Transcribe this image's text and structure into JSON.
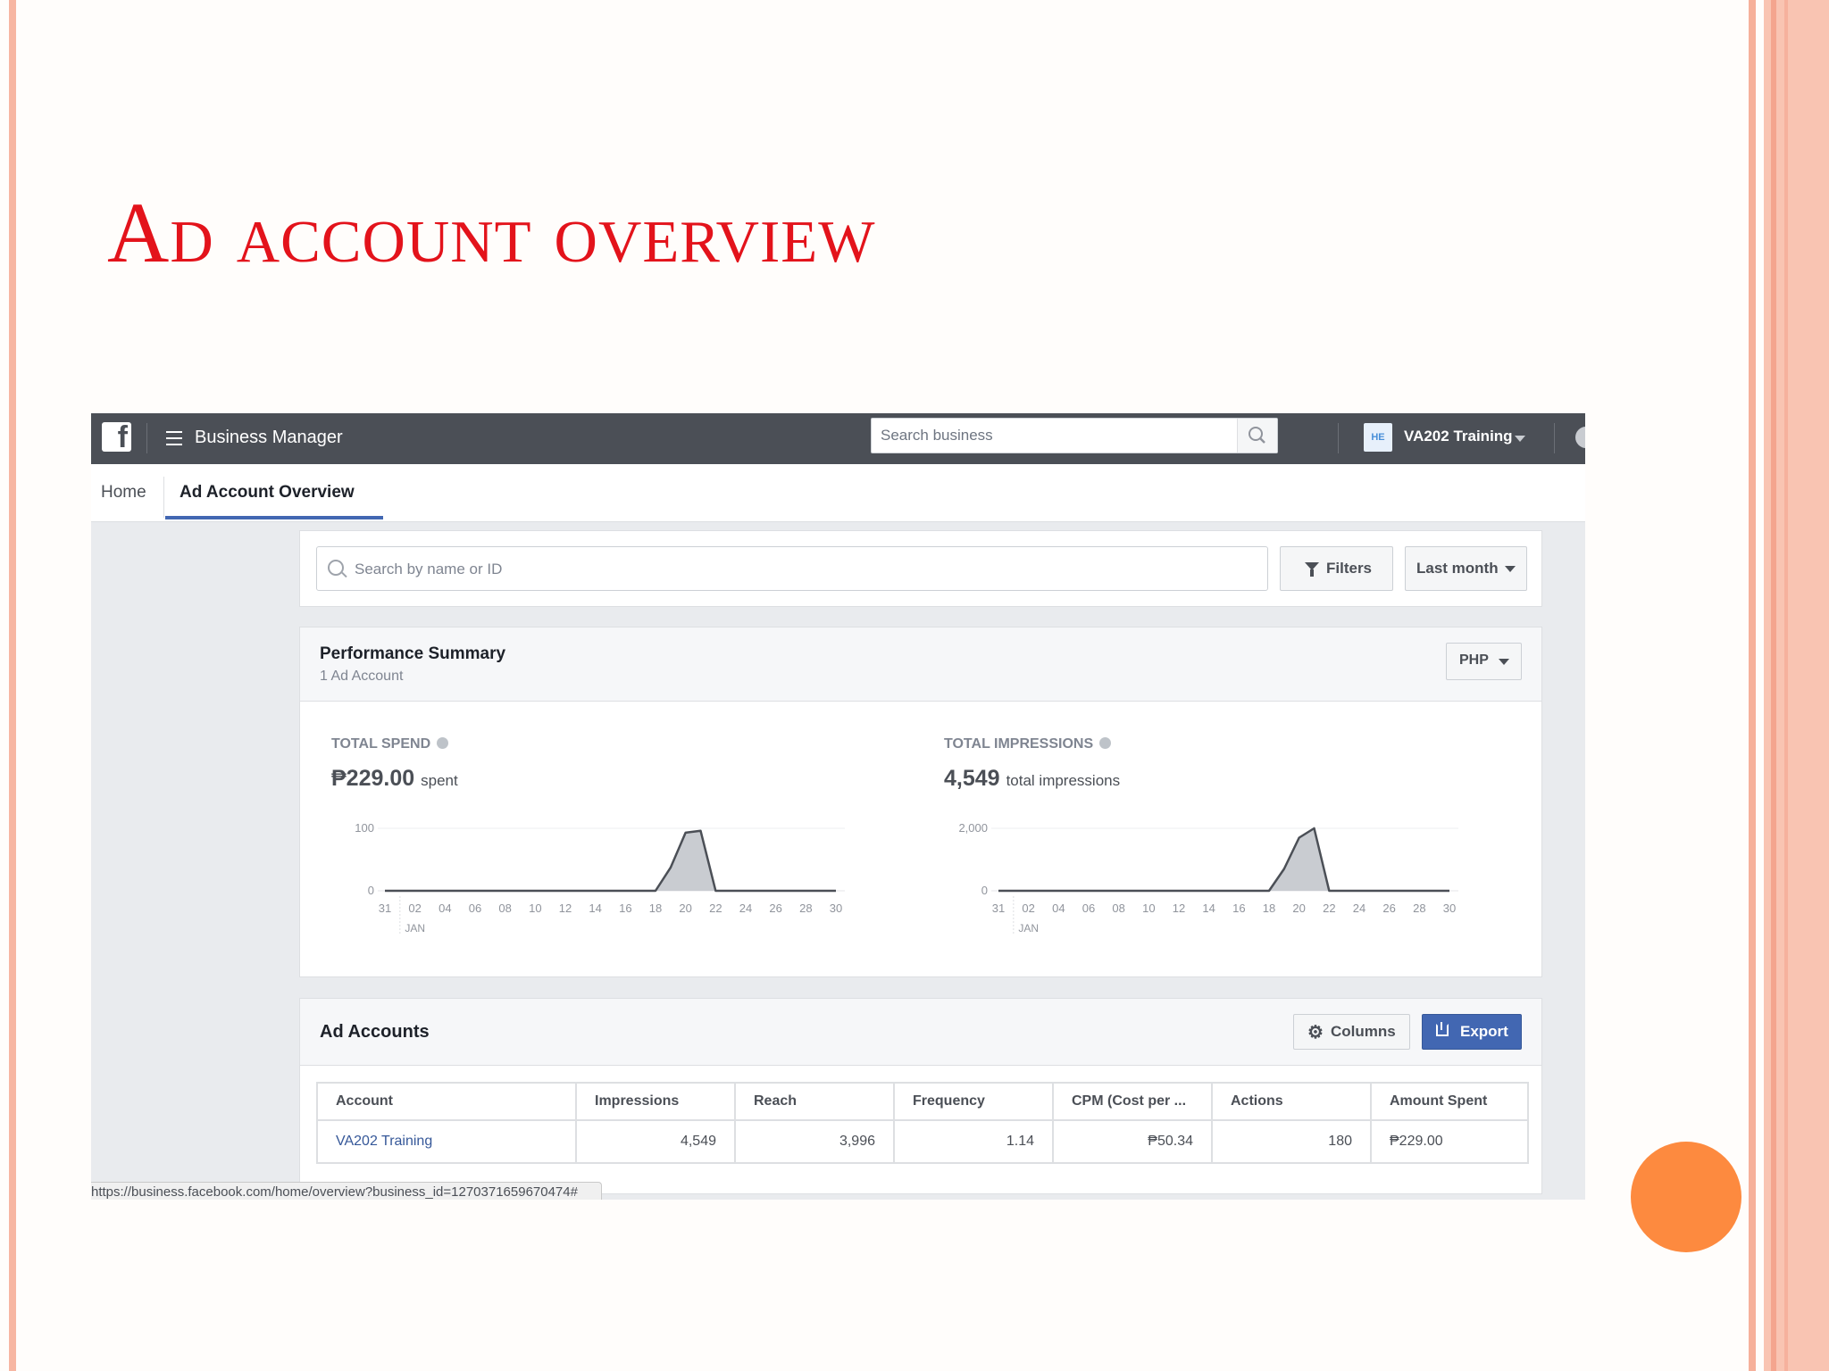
{
  "slide": {
    "title": "Ad account overview",
    "accent_color": "#e3131b",
    "decoration_circle_color": "#fd8a3f"
  },
  "topbar": {
    "logo_icon": "facebook-icon",
    "menu_icon": "hamburger-icon",
    "app_title": "Business Manager",
    "search_placeholder": "Search business",
    "business_badge": "HE",
    "business_name": "VA202 Training",
    "background_color": "#4b4f56"
  },
  "tabs": [
    {
      "label": "Home",
      "active": false
    },
    {
      "label": "Ad Account Overview",
      "active": true
    }
  ],
  "filters": {
    "search_placeholder": "Search by name or ID",
    "filters_label": "Filters",
    "period_label": "Last month"
  },
  "performance": {
    "title": "Performance Summary",
    "subtitle": "1 Ad Account",
    "currency": "PHP",
    "spend": {
      "label": "TOTAL SPEND",
      "value": "₱229.00",
      "unit": "spent"
    },
    "impressions": {
      "label": "TOTAL IMPRESSIONS",
      "value": "4,549",
      "unit": "total impressions"
    }
  },
  "chart_data": [
    {
      "type": "area",
      "title": "TOTAL SPEND",
      "x_ticks": [
        "31",
        "02",
        "04",
        "06",
        "08",
        "10",
        "12",
        "14",
        "16",
        "18",
        "20",
        "22",
        "24",
        "26",
        "28",
        "30"
      ],
      "x_sublabel": "JAN",
      "y_ticks": [
        "0",
        "100"
      ],
      "ylim": [
        0,
        100
      ],
      "x": [
        "31",
        "02",
        "04",
        "06",
        "08",
        "10",
        "12",
        "14",
        "16",
        "18",
        "19",
        "20",
        "21",
        "22",
        "23",
        "24",
        "26",
        "28",
        "30"
      ],
      "values": [
        0,
        0,
        0,
        0,
        0,
        0,
        0,
        0,
        0,
        0,
        37,
        93,
        96,
        0,
        0,
        0,
        0,
        0,
        0
      ],
      "color": "#c9ccd1",
      "line_color": "#4b4f56"
    },
    {
      "type": "area",
      "title": "TOTAL IMPRESSIONS",
      "x_ticks": [
        "31",
        "02",
        "04",
        "06",
        "08",
        "10",
        "12",
        "14",
        "16",
        "18",
        "20",
        "22",
        "24",
        "26",
        "28",
        "30"
      ],
      "x_sublabel": "JAN",
      "y_ticks": [
        "0",
        "2,000"
      ],
      "ylim": [
        0,
        2000
      ],
      "x": [
        "31",
        "02",
        "04",
        "06",
        "08",
        "10",
        "12",
        "14",
        "16",
        "18",
        "19",
        "20",
        "21",
        "22",
        "23",
        "24",
        "26",
        "28",
        "30"
      ],
      "values": [
        0,
        0,
        0,
        0,
        0,
        0,
        0,
        0,
        0,
        0,
        700,
        1700,
        2000,
        0,
        0,
        0,
        0,
        0,
        0
      ],
      "color": "#c9ccd1",
      "line_color": "#4b4f56"
    }
  ],
  "ad_accounts": {
    "title": "Ad Accounts",
    "columns_label": "Columns",
    "export_label": "Export",
    "headers": [
      "Account",
      "Impressions",
      "Reach",
      "Frequency",
      "CPM (Cost per ...",
      "Actions",
      "Amount Spent"
    ],
    "rows": [
      [
        "VA202 Training",
        "4,549",
        "3,996",
        "1.14",
        "₱50.34",
        "180",
        "₱229.00"
      ]
    ]
  },
  "status_bar": {
    "url": "https://business.facebook.com/home/overview?business_id=1270371659670474#"
  }
}
